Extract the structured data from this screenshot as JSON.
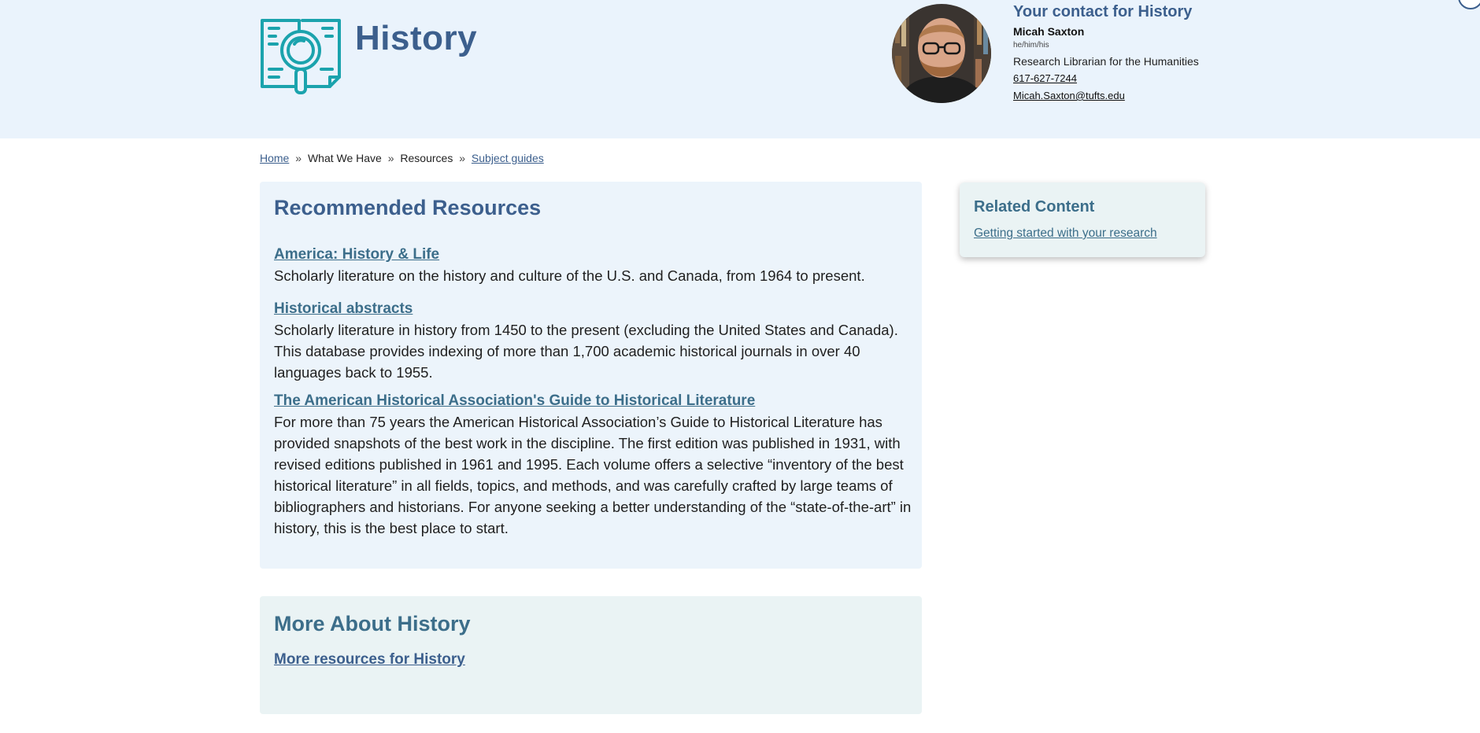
{
  "colors": {
    "header_bg": "#eaf3fc",
    "brand": "#3c5f8d",
    "teal_link": "#3c6e8a",
    "icon_teal": "#1ba3ad"
  },
  "header": {
    "title": "History",
    "icon": "book-magnifier-icon",
    "contact": {
      "heading": "Your contact for History",
      "name": "Micah Saxton",
      "pronouns": "he/him/his",
      "role": "Research Librarian for the Humanities",
      "phone": "617-627-7244",
      "email": "Micah.Saxton@tufts.edu"
    }
  },
  "breadcrumb": {
    "home": "Home",
    "separator": "»",
    "what_we_have": "What We Have",
    "resources": "Resources",
    "subject_guides": "Subject guides"
  },
  "recommended": {
    "heading": "Recommended Resources",
    "items": [
      {
        "title": "America: History & Life",
        "description": "Scholarly literature on the history and culture of the U.S. and Canada, from 1964 to present."
      },
      {
        "title": "Historical abstracts",
        "description": "Scholarly literature in history from 1450 to the present (excluding the United States and Canada). This database provides indexing of more than 1,700 academic historical journals in over 40 languages back to 1955."
      },
      {
        "title": "The American Historical Association's Guide to Historical Literature",
        "description": "For more than 75 years the American Historical Association’s Guide to Historical Literature has provided snapshots of the best work in the discipline. The first edition was published in 1931, with revised editions published in 1961 and 1995. Each volume offers a selective “inventory of the best historical literature” in all fields, topics, and methods, and was carefully crafted by large teams of bibliographers and historians. For anyone seeking a better understanding of the “state-of-the-art” in history, this is the best place to start."
      }
    ]
  },
  "more_about": {
    "heading": "More About History",
    "link": "More resources for History"
  },
  "related": {
    "heading": "Related Content",
    "link": "Getting started with your research"
  }
}
